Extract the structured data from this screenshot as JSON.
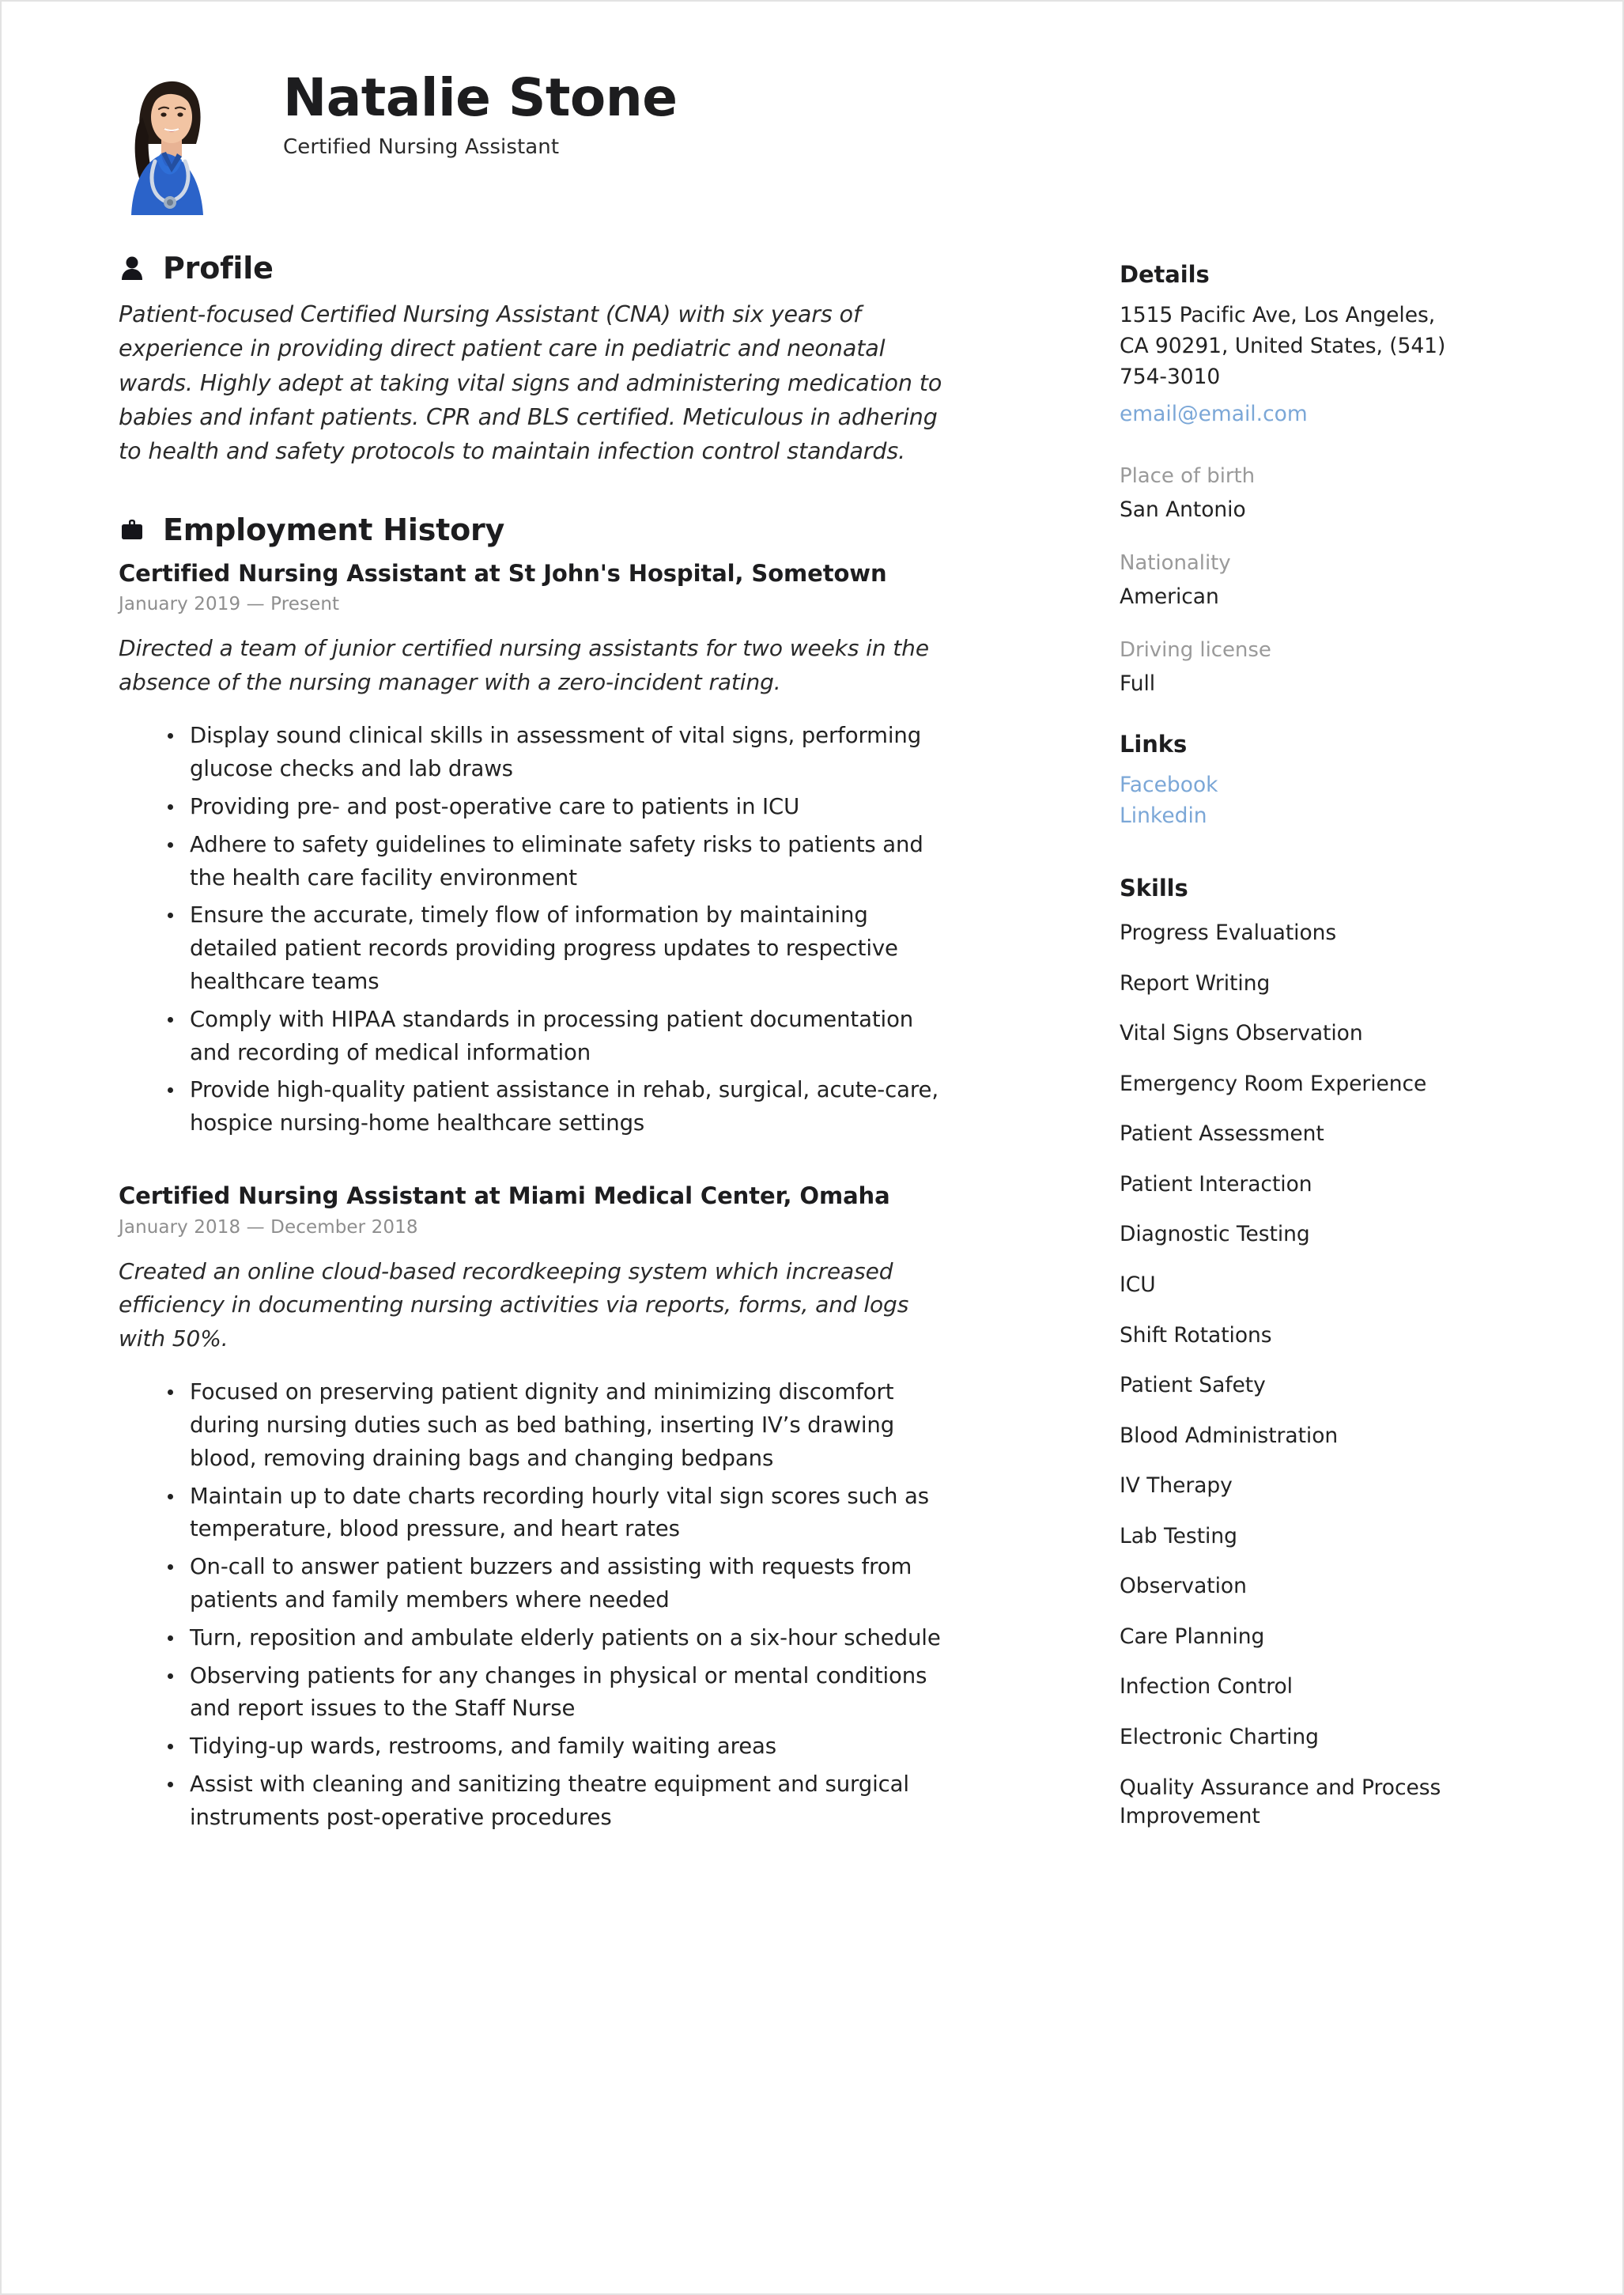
{
  "header": {
    "name": "Natalie Stone",
    "title": "Certified Nursing Assistant",
    "avatar_icon": "portrait-photo"
  },
  "profile": {
    "heading": "Profile",
    "icon": "person-icon",
    "text": "Patient-focused Certified Nursing Assistant (CNA) with six years of experience in providing direct patient care in pediatric and neonatal wards. Highly adept at taking vital signs and administering medication to babies and infant patients. CPR and BLS certified. Meticulous in adhering to health and safety protocols to maintain infection control standards."
  },
  "employment": {
    "heading": "Employment History",
    "icon": "briefcase-icon",
    "jobs": [
      {
        "heading": "Certified Nursing Assistant at  St John's Hospital, Sometown",
        "dates": "January 2019 — Present",
        "summary": "Directed a team of junior certified nursing assistants for two weeks in the absence of the nursing manager with a zero-incident rating.",
        "bullets": [
          "Display sound clinical skills in assessment of vital signs, performing glucose checks and lab draws",
          "Providing pre- and post-operative care to patients in ICU",
          "Adhere to safety guidelines to eliminate safety risks to patients and the health care facility environment",
          "Ensure the accurate, timely flow of information by maintaining detailed patient records providing progress updates to respective healthcare teams",
          "Comply with HIPAA standards in processing patient documentation and recording of medical information",
          "Provide high-quality patient assistance in rehab, surgical, acute-care, hospice nursing-home healthcare settings"
        ]
      },
      {
        "heading": "Certified Nursing Assistant at  Miami Medical Center, Omaha",
        "dates": "January 2018 — December 2018",
        "summary": "Created an online cloud-based recordkeeping system which increased efficiency in documenting nursing activities via  reports, forms, and logs with 50%.",
        "bullets": [
          "Focused on preserving patient dignity and minimizing discomfort during nursing duties such as bed bathing, inserting IV’s drawing blood, removing draining bags and changing bedpans",
          "Maintain up to date charts recording hourly vital sign scores such as temperature, blood pressure, and heart rates",
          "On-call to answer patient buzzers and assisting with requests from patients and family members where needed",
          "Turn, reposition and ambulate elderly patients on a six-hour schedule",
          "Observing patients for any changes in physical or mental conditions and report issues to the Staff Nurse",
          "Tidying-up wards, restrooms, and family waiting areas",
          "Assist with cleaning and sanitizing theatre equipment and surgical instruments post-operative procedures"
        ]
      }
    ]
  },
  "details": {
    "heading": "Details",
    "address_lines": [
      "1515 Pacific Ave, Los Angeles,",
      "CA 90291, United States, (541)",
      "754-3010"
    ],
    "email": "email@email.com",
    "fields": [
      {
        "label": "Place of birth",
        "value": "San Antonio"
      },
      {
        "label": "Nationality",
        "value": "American"
      },
      {
        "label": "Driving license",
        "value": "Full"
      }
    ]
  },
  "links": {
    "heading": "Links",
    "items": [
      "Facebook",
      "Linkedin"
    ]
  },
  "skills": {
    "heading": "Skills",
    "items": [
      "Progress Evaluations",
      "Report Writing",
      "Vital Signs Observation",
      "Emergency Room Experience",
      "Patient Assessment",
      "Patient Interaction",
      "Diagnostic Testing",
      "ICU",
      "Shift Rotations",
      "Patient Safety",
      "Blood Administration",
      "IV Therapy",
      "Lab Testing",
      "Observation",
      "Care Planning",
      "Infection Control",
      "Electronic Charting",
      "Quality Assurance and Process Improvement"
    ]
  },
  "colors": {
    "link": "#7ba7d7",
    "label_gray": "#9a9a9a",
    "text": "#222222",
    "heading": "#1d1d1f"
  }
}
